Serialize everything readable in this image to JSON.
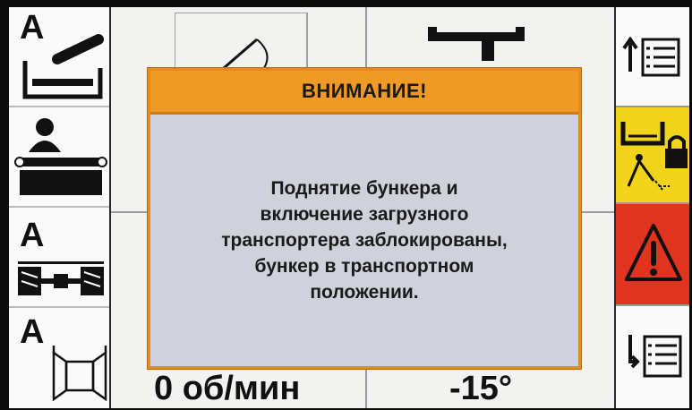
{
  "left_panel": {
    "buttons": [
      {
        "letter": "A",
        "icon": "hopper-tilt-icon"
      },
      {
        "letter": "",
        "icon": "loading-conveyor-icon"
      },
      {
        "letter": "A",
        "icon": "axle-steering-icon"
      },
      {
        "letter": "A",
        "icon": "bunker-door-icon"
      }
    ]
  },
  "right_panel": {
    "buttons": [
      {
        "icon": "list-up-icon"
      },
      {
        "icon": "hopper-lock-icon",
        "color": "#f2d41a"
      },
      {
        "icon": "warning-icon",
        "color": "#e0341f"
      },
      {
        "icon": "list-down-icon"
      }
    ]
  },
  "readouts": {
    "speed": "0 об/мин",
    "angle": "-15°"
  },
  "dialog": {
    "title": "ВНИМАНИЕ!",
    "message": "Поднятие бункера и\nвключение загрузного\nтранспортера заблокированы,\nбункер в транспортном\nположении.",
    "header_color": "#f09a26",
    "body_color": "#cfd2da"
  }
}
